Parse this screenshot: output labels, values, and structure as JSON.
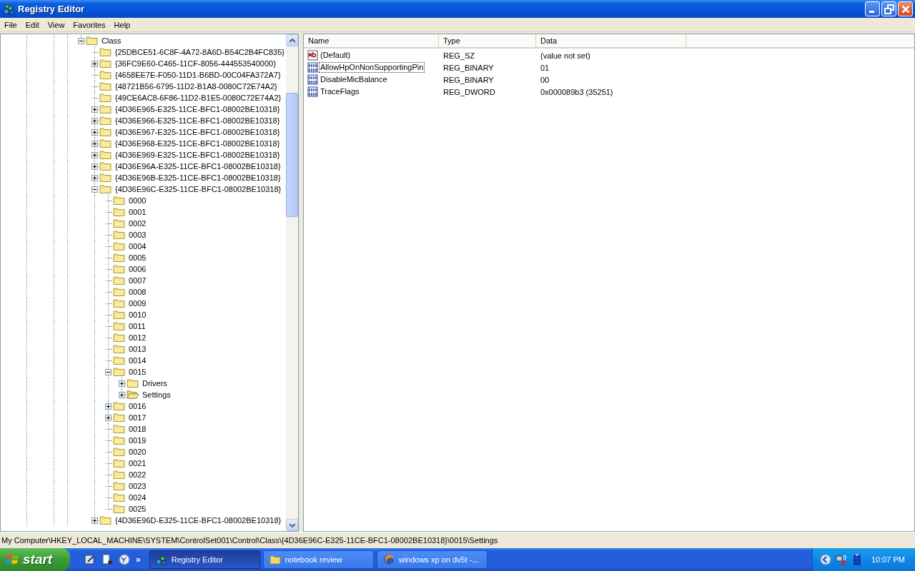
{
  "window": {
    "title": "Registry Editor"
  },
  "menu": [
    "File",
    "Edit",
    "View",
    "Favorites",
    "Help"
  ],
  "tree": {
    "items": [
      {
        "label": "Class",
        "kind": "expanded",
        "selected": false,
        "children": [
          {
            "label": "{25DBCE51-6C8F-4A72-8A6D-B54C2B4FC835}",
            "kind": "leaf",
            "selected": false
          },
          {
            "label": "{36FC9E60-C465-11CF-8056-444553540000}",
            "kind": "collapsed",
            "selected": false
          },
          {
            "label": "{4658EE7E-F050-11D1-B6BD-00C04FA372A7}",
            "kind": "leaf",
            "selected": false
          },
          {
            "label": "{48721B56-6795-11D2-B1A8-0080C72E74A2}",
            "kind": "leaf",
            "selected": false
          },
          {
            "label": "{49CE6AC8-6F86-11D2-B1E5-0080C72E74A2}",
            "kind": "leaf",
            "selected": false
          },
          {
            "label": "{4D36E965-E325-11CE-BFC1-08002BE10318}",
            "kind": "collapsed",
            "selected": false
          },
          {
            "label": "{4D36E966-E325-11CE-BFC1-08002BE10318}",
            "kind": "collapsed",
            "selected": false
          },
          {
            "label": "{4D36E967-E325-11CE-BFC1-08002BE10318}",
            "kind": "collapsed",
            "selected": false
          },
          {
            "label": "{4D36E968-E325-11CE-BFC1-08002BE10318}",
            "kind": "collapsed",
            "selected": false
          },
          {
            "label": "{4D36E969-E325-11CE-BFC1-08002BE10318}",
            "kind": "collapsed",
            "selected": false
          },
          {
            "label": "{4D36E96A-E325-11CE-BFC1-08002BE10318}",
            "kind": "collapsed",
            "selected": false
          },
          {
            "label": "{4D36E96B-E325-11CE-BFC1-08002BE10318}",
            "kind": "collapsed",
            "selected": false
          },
          {
            "label": "{4D36E96C-E325-11CE-BFC1-08002BE10318}",
            "kind": "expanded",
            "selected": false,
            "children": [
              {
                "label": "0000",
                "kind": "leaf",
                "selected": false
              },
              {
                "label": "0001",
                "kind": "leaf",
                "selected": false
              },
              {
                "label": "0002",
                "kind": "leaf",
                "selected": false
              },
              {
                "label": "0003",
                "kind": "leaf",
                "selected": false
              },
              {
                "label": "0004",
                "kind": "leaf",
                "selected": false
              },
              {
                "label": "0005",
                "kind": "leaf",
                "selected": false
              },
              {
                "label": "0006",
                "kind": "leaf",
                "selected": false
              },
              {
                "label": "0007",
                "kind": "leaf",
                "selected": false
              },
              {
                "label": "0008",
                "kind": "leaf",
                "selected": false
              },
              {
                "label": "0009",
                "kind": "leaf",
                "selected": false
              },
              {
                "label": "0010",
                "kind": "leaf",
                "selected": false
              },
              {
                "label": "0011",
                "kind": "leaf",
                "selected": false
              },
              {
                "label": "0012",
                "kind": "leaf",
                "selected": false
              },
              {
                "label": "0013",
                "kind": "leaf",
                "selected": false
              },
              {
                "label": "0014",
                "kind": "leaf",
                "selected": false
              },
              {
                "label": "0015",
                "kind": "expanded",
                "selected": false,
                "children": [
                  {
                    "label": "Drivers",
                    "kind": "collapsed",
                    "selected": false
                  },
                  {
                    "label": "Settings",
                    "kind": "collapsed",
                    "selected": true
                  }
                ]
              },
              {
                "label": "0016",
                "kind": "collapsed",
                "selected": false
              },
              {
                "label": "0017",
                "kind": "collapsed",
                "selected": false
              },
              {
                "label": "0018",
                "kind": "leaf",
                "selected": false
              },
              {
                "label": "0019",
                "kind": "leaf",
                "selected": false
              },
              {
                "label": "0020",
                "kind": "leaf",
                "selected": false
              },
              {
                "label": "0021",
                "kind": "leaf",
                "selected": false
              },
              {
                "label": "0022",
                "kind": "leaf",
                "selected": false
              },
              {
                "label": "0023",
                "kind": "leaf",
                "selected": false
              },
              {
                "label": "0024",
                "kind": "leaf",
                "selected": false
              },
              {
                "label": "0025",
                "kind": "leaf",
                "selected": false
              }
            ]
          },
          {
            "label": "{4D36E96D-E325-11CE-BFC1-08002BE10318}",
            "kind": "collapsed",
            "selected": false
          }
        ]
      }
    ]
  },
  "values": {
    "columns": [
      "Name",
      "Type",
      "Data"
    ],
    "rows": [
      {
        "kind": "string",
        "name": "(Default)",
        "type": "REG_SZ",
        "data": "(value not set)",
        "focused": false
      },
      {
        "kind": "binary",
        "name": "AllowHpOnNonSupportingPin",
        "type": "REG_BINARY",
        "data": "01",
        "focused": true
      },
      {
        "kind": "binary",
        "name": "DisableMicBalance",
        "type": "REG_BINARY",
        "data": "00",
        "focused": false
      },
      {
        "kind": "binary",
        "name": "TraceFlags",
        "type": "REG_DWORD",
        "data": "0x000089b3 (35251)",
        "focused": false
      }
    ]
  },
  "status_bar": "My Computer\\HKEY_LOCAL_MACHINE\\SYSTEM\\ControlSet001\\Control\\Class\\{4D36E96C-E325-11CE-BFC1-08002BE10318}\\0015\\Settings",
  "taskbar": {
    "start": "start",
    "quick_launch_more": "»",
    "tasks": [
      {
        "kind": "registry",
        "label": "Registry Editor",
        "selected": true
      },
      {
        "kind": "folder",
        "label": "notebook review",
        "selected": false
      },
      {
        "kind": "browser",
        "label": "windows xp on dv5t -...",
        "selected": false
      }
    ],
    "clock": "10:07 PM"
  }
}
